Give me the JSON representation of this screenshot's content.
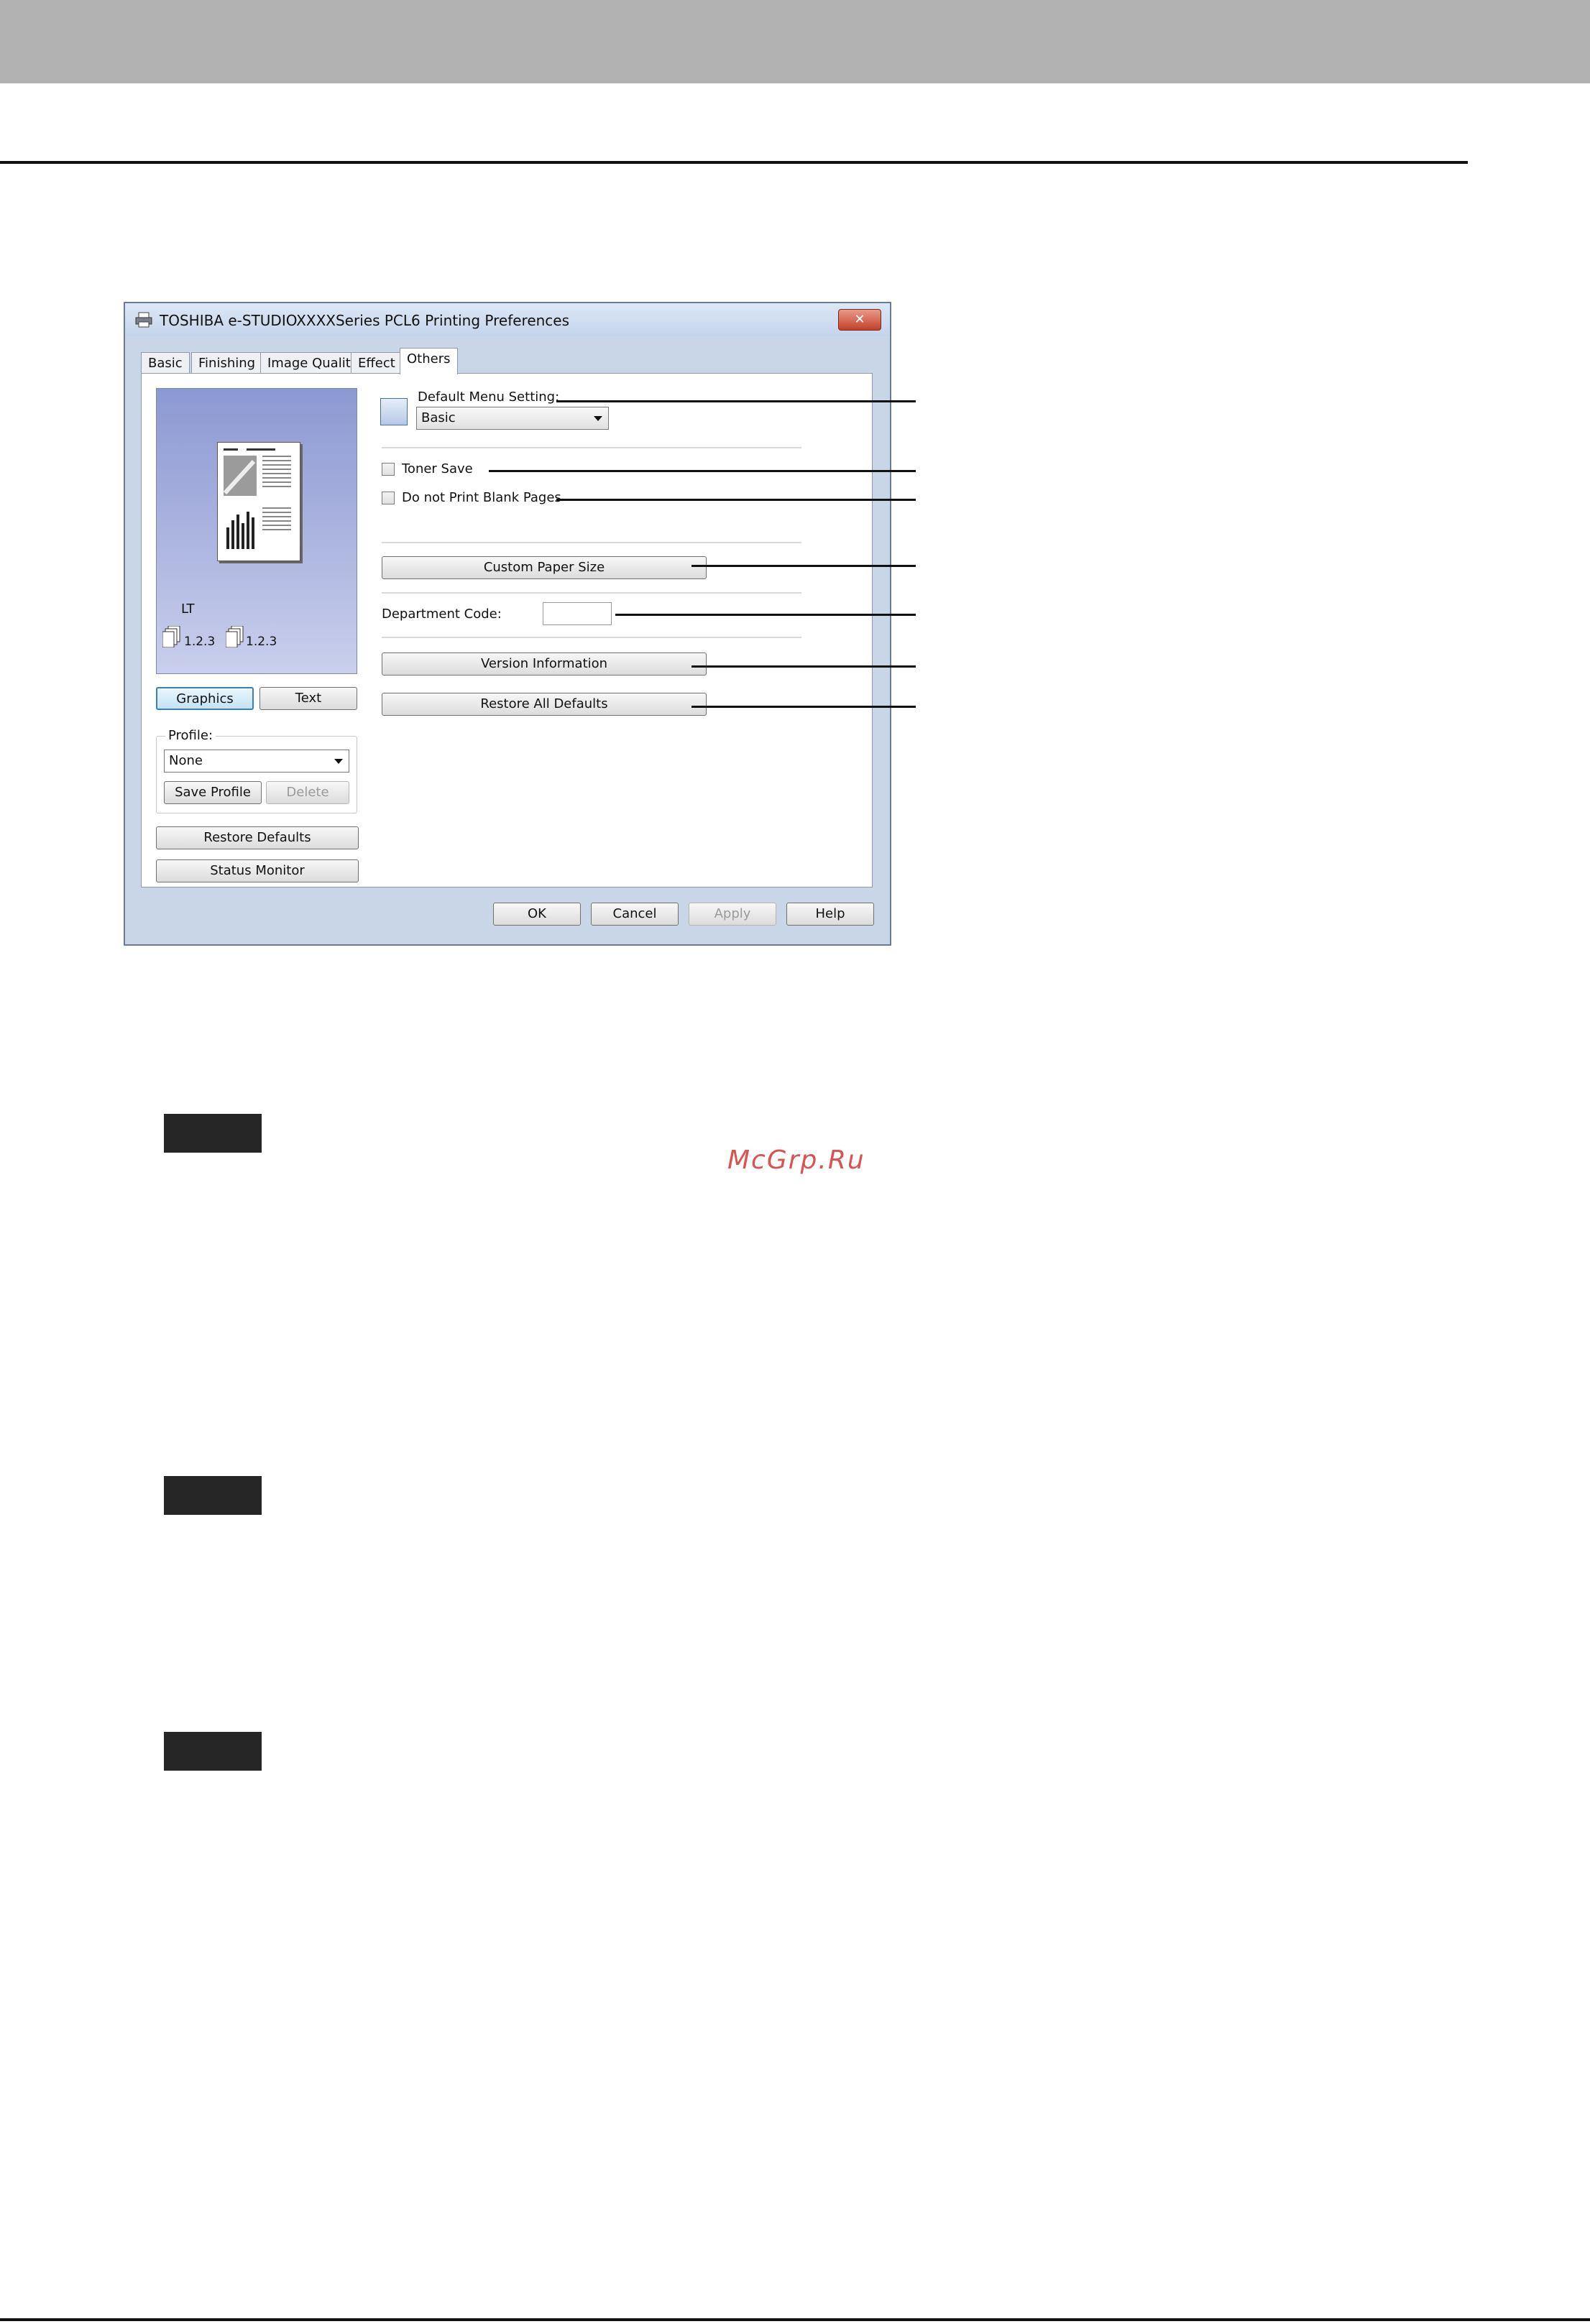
{
  "dialog": {
    "title": "TOSHIBA e-STUDIOXXXXSeries PCL6 Printing Preferences",
    "close_label": "✕",
    "tabs": [
      {
        "label": "Basic"
      },
      {
        "label": "Finishing"
      },
      {
        "label": "Image Quality"
      },
      {
        "label": "Effect"
      },
      {
        "label": "Others"
      }
    ],
    "preview": {
      "paper": "LT",
      "stack_1": "1.2.3",
      "stack_2": "1.2.3"
    },
    "view_buttons": {
      "graphics": "Graphics",
      "text": "Text"
    },
    "profile": {
      "group_label": "Profile:",
      "selected": "None",
      "save_label": "Save Profile",
      "delete_label": "Delete"
    },
    "restore_defaults_label": "Restore Defaults",
    "status_monitor_label": "Status Monitor",
    "others": {
      "default_menu_label": "Default Menu Setting:",
      "default_menu_value": "Basic",
      "toner_save_label": "Toner Save",
      "no_blank_pages_label": "Do not Print Blank Pages",
      "custom_paper_label": "Custom Paper Size",
      "department_code_label": "Department Code:",
      "department_code_value": "",
      "version_info_label": "Version Information",
      "restore_all_label": "Restore All Defaults"
    },
    "footer": {
      "ok": "OK",
      "cancel": "Cancel",
      "apply": "Apply",
      "help": "Help"
    }
  },
  "watermark": "McGrp.Ru"
}
